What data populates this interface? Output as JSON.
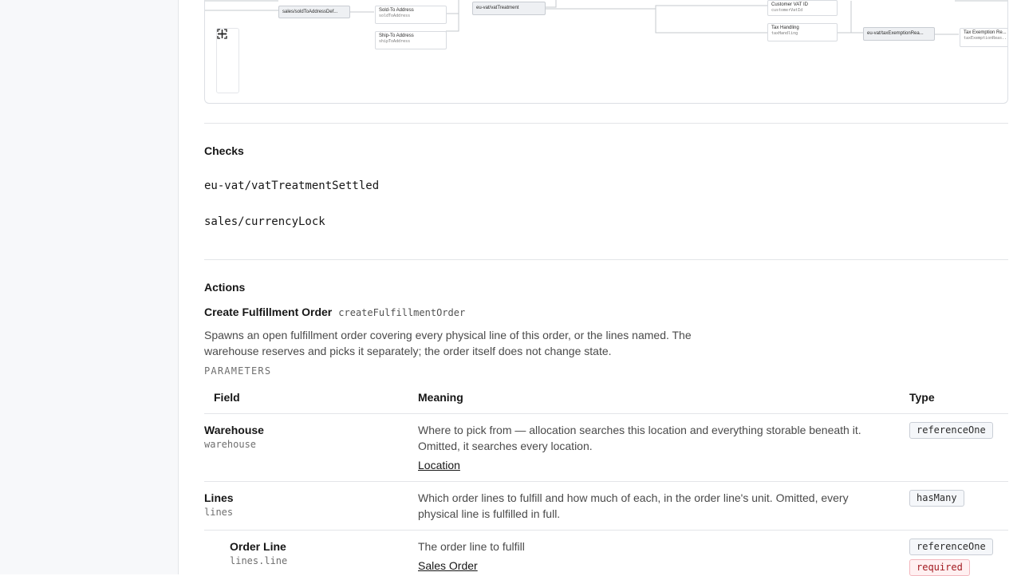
{
  "diagram": {
    "nodes": {
      "sold_to_default": {
        "label": "sales/soldToAddressDef..."
      },
      "sold_to": {
        "label": "Sold-To Address",
        "api": "soldToAddress"
      },
      "ship_to": {
        "label": "Ship-To Address",
        "api": "shipToAddress"
      },
      "vat_treatment": {
        "label": "eu-vat/vatTreatment"
      },
      "customer_vat": {
        "label": "Customer VAT ID",
        "api": "customerVatId"
      },
      "tax_handling": {
        "label": "Tax Handling",
        "api": "taxHandling"
      },
      "tax_exemption_rel": {
        "label": "eu-vat/taxExemptionRea..."
      },
      "tax_exemption": {
        "label": "Tax Exemption Re...",
        "api": "taxExemptionReas..."
      }
    },
    "controls": {
      "zoom_in": "plus-icon",
      "zoom_out": "minus-icon",
      "fit": "fit-view-icon"
    }
  },
  "checks": {
    "title": "Checks",
    "items": [
      "eu-vat/vatTreatmentSettled",
      "sales/currencyLock"
    ]
  },
  "actions": {
    "title": "Actions",
    "action": {
      "label": "Create Fulfillment Order",
      "api": "createFulfillmentOrder",
      "description": "Spawns an open fulfillment order covering every physical line of this order, or the lines named. The warehouse reserves and picks it separately; the order itself does not change state.",
      "params_label": "PARAMETERS",
      "columns": {
        "field": "Field",
        "meaning": "Meaning",
        "type": "Type"
      },
      "params": [
        {
          "label": "Warehouse",
          "api": "warehouse",
          "meaning": "Where to pick from — allocation searches this location and everything storable beneath it. Omitted, it searches every location.",
          "link": "Location",
          "type": "referenceOne"
        },
        {
          "label": "Lines",
          "api": "lines",
          "meaning": "Which order lines to fulfill and how much of each, in the order line's unit. Omitted, every physical line is fulfilled in full.",
          "type": "hasMany"
        },
        {
          "label": "Order Line",
          "api": "lines.line",
          "meaning": "The order line to fulfill",
          "link": "Sales Order",
          "type": "referenceOne",
          "required": "required"
        }
      ]
    }
  }
}
